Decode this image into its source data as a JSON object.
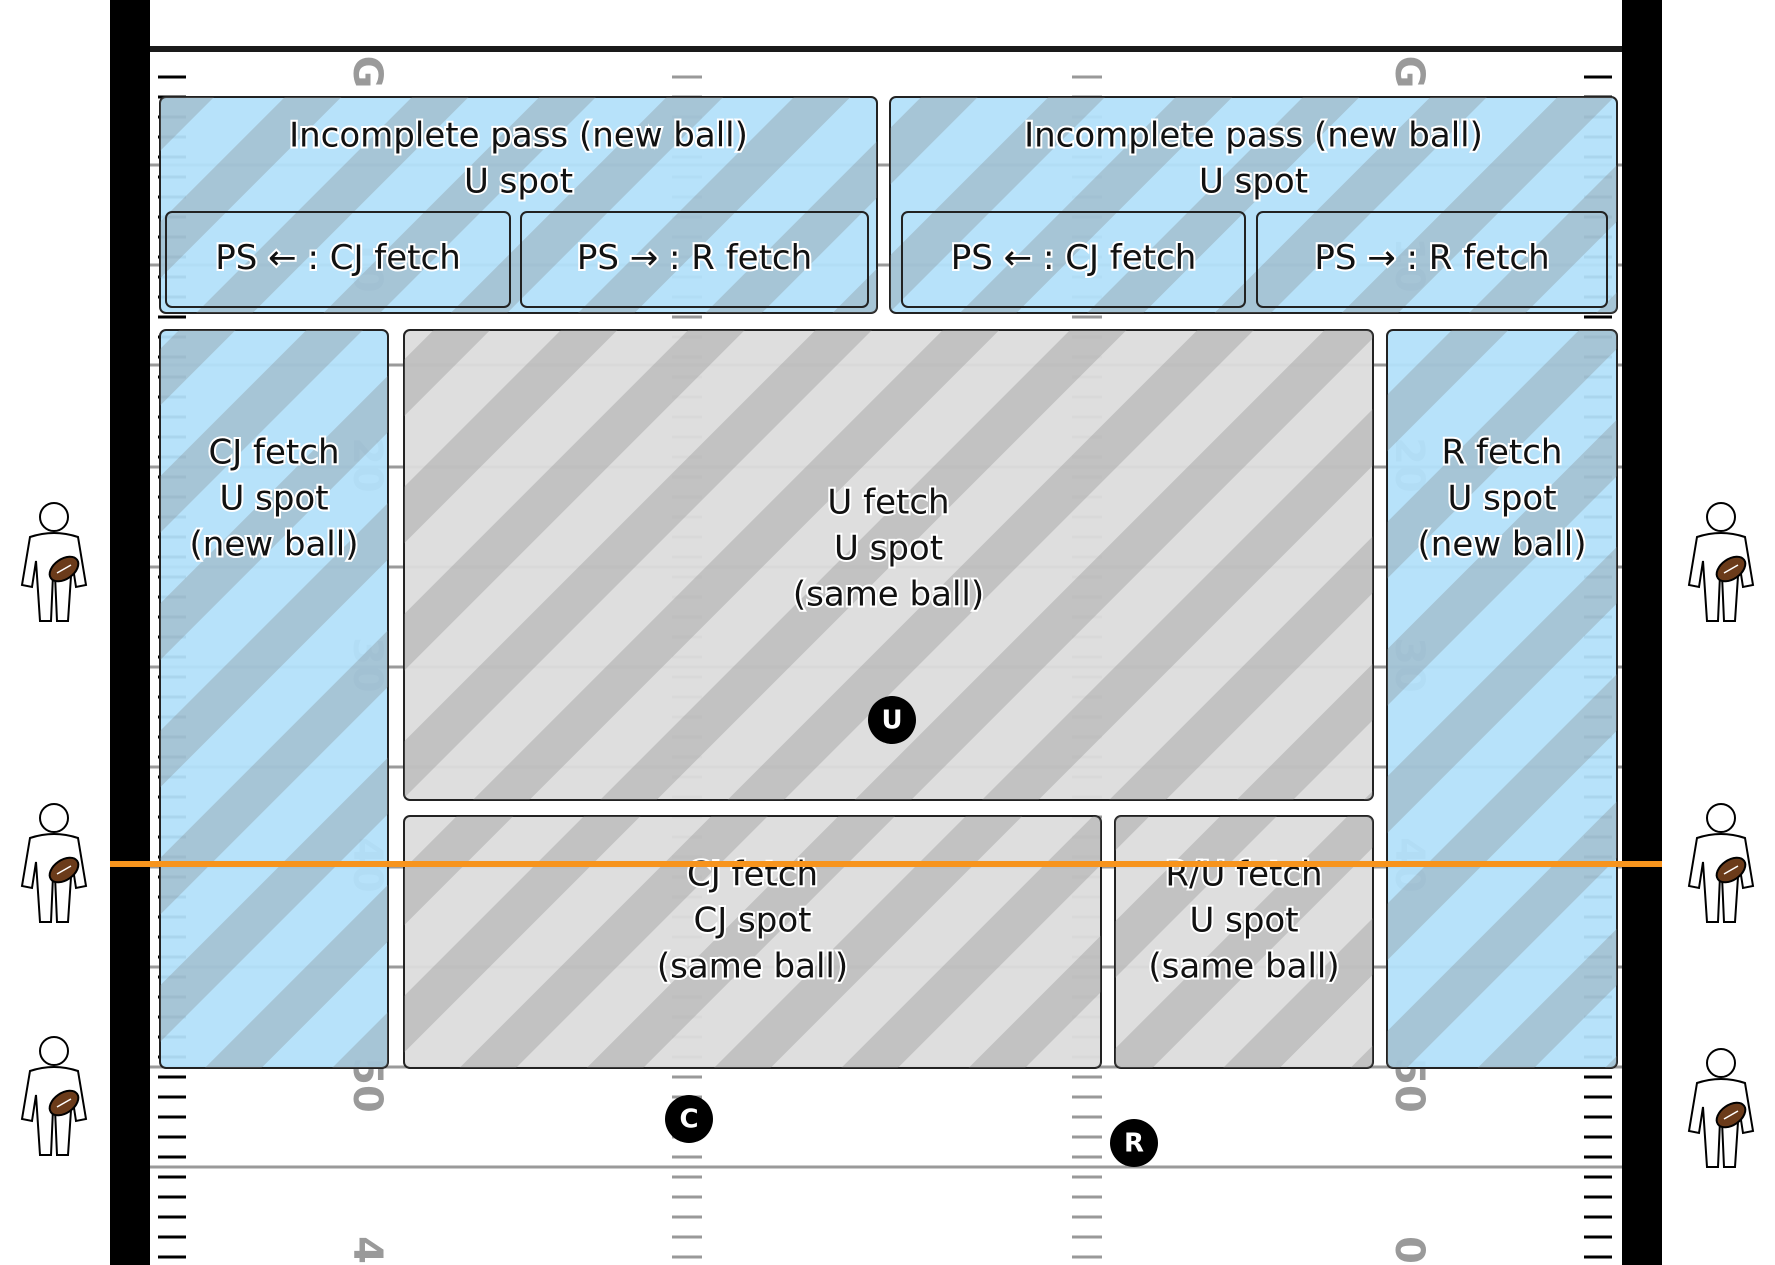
{
  "colors": {
    "zone_blue": "#b3e0fa",
    "zone_gray": "#dcdcdc",
    "stripe": "#7a7a7a",
    "sideline": "#000000",
    "line_to_gain": "#f7941d",
    "field_line": "#9a9a9a",
    "ball": "#6b3b1a"
  },
  "yard_numbers_left": [
    "G",
    "10",
    "20",
    "30",
    "40",
    "50",
    "4"
  ],
  "yard_numbers_right": [
    "G",
    "10",
    "20",
    "30",
    "40",
    "50",
    "0"
  ],
  "zones": [
    {
      "kind": "blue",
      "lines": [
        "Incomplete pass (new ball)",
        "U spot"
      ]
    },
    {
      "kind": "blue",
      "lines": [
        "Incomplete pass (new ball)",
        "U spot"
      ]
    },
    {
      "kind": "blue",
      "lines": [
        "PS ← : CJ fetch"
      ]
    },
    {
      "kind": "blue",
      "lines": [
        "PS → : R fetch"
      ]
    },
    {
      "kind": "blue",
      "lines": [
        "PS ← : CJ fetch"
      ]
    },
    {
      "kind": "blue",
      "lines": [
        "PS → : R fetch"
      ]
    },
    {
      "kind": "blue",
      "lines": [
        "CJ fetch",
        "U spot",
        "(new ball)"
      ]
    },
    {
      "kind": "gray",
      "lines": [
        "U fetch",
        "U spot",
        "(same ball)"
      ]
    },
    {
      "kind": "blue",
      "lines": [
        "R fetch",
        "U spot",
        "(new ball)"
      ]
    },
    {
      "kind": "gray",
      "lines": [
        "CJ fetch",
        "CJ spot",
        "(same ball)"
      ]
    },
    {
      "kind": "gray",
      "lines": [
        "R/U fetch",
        "U spot",
        "(same ball)"
      ]
    }
  ],
  "officials": [
    {
      "label": "U",
      "name": "umpire"
    },
    {
      "label": "C",
      "name": "center-judge"
    },
    {
      "label": "R",
      "name": "referee"
    }
  ],
  "ball_persons": 6
}
